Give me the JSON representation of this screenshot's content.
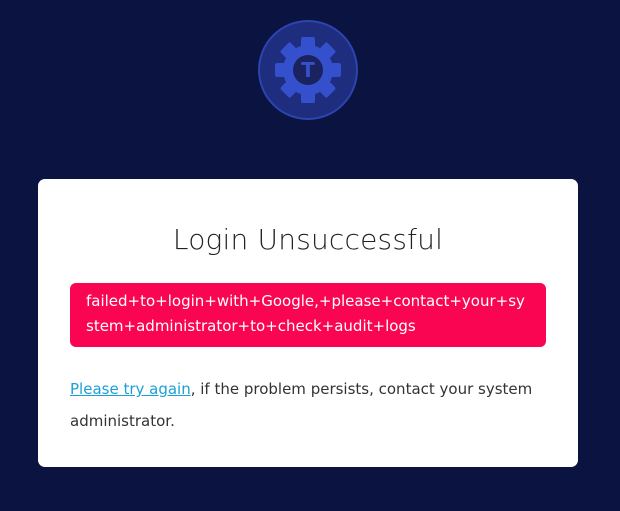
{
  "logo": {
    "icon": "gear-t-logo-icon",
    "letter": "T",
    "colors": {
      "ring": "#243a9c",
      "circle": "#1e2d7e",
      "gear": "#3550cc",
      "inner": "#1a2260"
    }
  },
  "card": {
    "title": "Login Unsuccessful",
    "error_message": "failed+to+login+with+Google,+please+contact+your+system+administrator+to+check+audit+logs",
    "retry_link": "Please try again",
    "help_suffix": ", if the problem persists, contact your system administrator."
  },
  "colors": {
    "background": "#0b1340",
    "card": "#ffffff",
    "error": "#f90552",
    "link": "#1aa0d8"
  }
}
